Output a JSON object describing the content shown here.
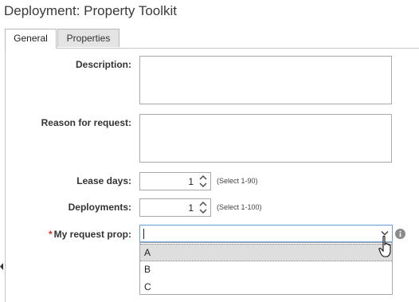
{
  "page": {
    "title": "Deployment: Property Toolkit"
  },
  "tabs": [
    {
      "label": "General",
      "active": true
    },
    {
      "label": "Properties",
      "active": false
    }
  ],
  "form": {
    "description_label": "Description:",
    "reason_label": "Reason for request:",
    "lease_days": {
      "label": "Lease days:",
      "value": "1",
      "hint": "(Select 1-90)"
    },
    "deployments": {
      "label": "Deployments:",
      "value": "1",
      "hint": "(Select 1-100)"
    },
    "request_prop": {
      "required_mark": "*",
      "label": "My request prop:",
      "value": "",
      "options": [
        "A",
        "B",
        "C"
      ],
      "highlighted_option": "A"
    }
  },
  "icons": {
    "info": "info-icon",
    "chevron": "chevron-down-icon",
    "cursor": "hand-pointer-icon"
  },
  "colors": {
    "focus_border": "#6a9ed5",
    "required": "#d9312b",
    "info_icon": "#8a8a8a",
    "highlight": "#dedede"
  }
}
